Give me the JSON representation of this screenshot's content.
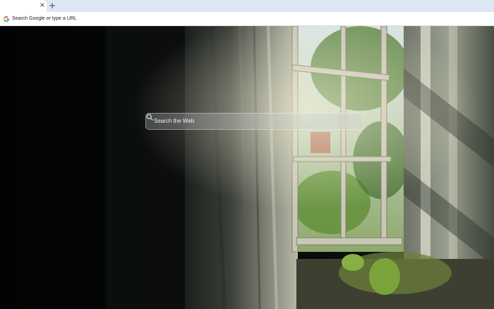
{
  "browser": {
    "tab_close_glyph": "×",
    "new_tab_glyph": "+",
    "omnibox_placeholder": "Search Google or type a URL",
    "omnibox_icon": "google-g-icon"
  },
  "ntp": {
    "search_placeholder": "Search the Web",
    "search_icon": "magnifier-icon",
    "background": "abandoned room with sunlit window and vines"
  },
  "colors": {
    "tabstrip": "#dfe7f5",
    "toolbar": "#ffffff",
    "search_text": "#f1f3f4"
  }
}
